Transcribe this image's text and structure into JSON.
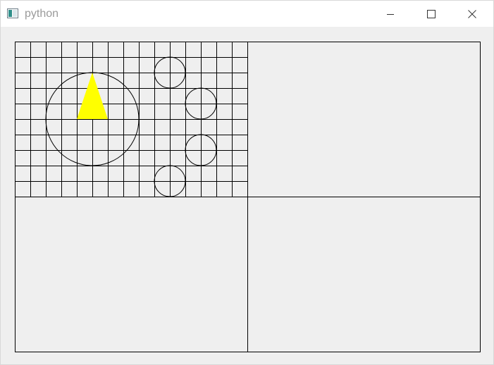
{
  "window": {
    "title": "python",
    "app_icon": "window-app-icon",
    "controls": [
      {
        "name": "minimize",
        "icon": "minimize-icon"
      },
      {
        "name": "maximize",
        "icon": "maximize-icon"
      },
      {
        "name": "close",
        "icon": "close-icon"
      }
    ]
  },
  "canvas": {
    "background": "#efefef",
    "line_color": "#000000",
    "triangle_color": "#ffff00",
    "quadrants": [
      "top-left",
      "top-right",
      "bottom-left",
      "bottom-right"
    ],
    "grid": {
      "columns": 15,
      "rows": 10
    },
    "big_circle": {
      "radius_cells": 3
    },
    "small_circles": 4
  }
}
